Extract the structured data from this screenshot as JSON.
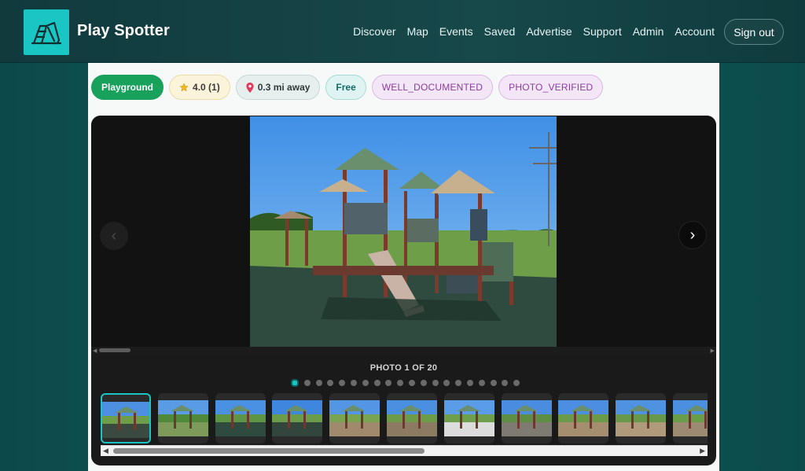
{
  "app": {
    "title": "Play Spotter"
  },
  "nav": [
    "Discover",
    "Map",
    "Events",
    "Saved",
    "Advertise",
    "Support",
    "Admin",
    "Account"
  ],
  "header": {
    "signout_label": "Sign out"
  },
  "badges": {
    "type": "Playground",
    "rating": "4.0 (1)",
    "distance": "0.3 mi away",
    "price": "Free",
    "tag1": "WELL_DOCUMENTED",
    "tag2": "PHOTO_VERIFIED"
  },
  "gallery": {
    "counter": "PHOTO 1 OF 20",
    "total_photos": 20,
    "current_photo": 1,
    "prev_icon": "chevron-left-icon",
    "next_icon": "chevron-right-icon",
    "next_label": "›",
    "prev_label": "‹"
  },
  "colors": {
    "accent": "#19c6c4",
    "header_bg": "#15434a",
    "badge_green": "#17a15a",
    "badge_purple_text": "#8b3da0"
  }
}
